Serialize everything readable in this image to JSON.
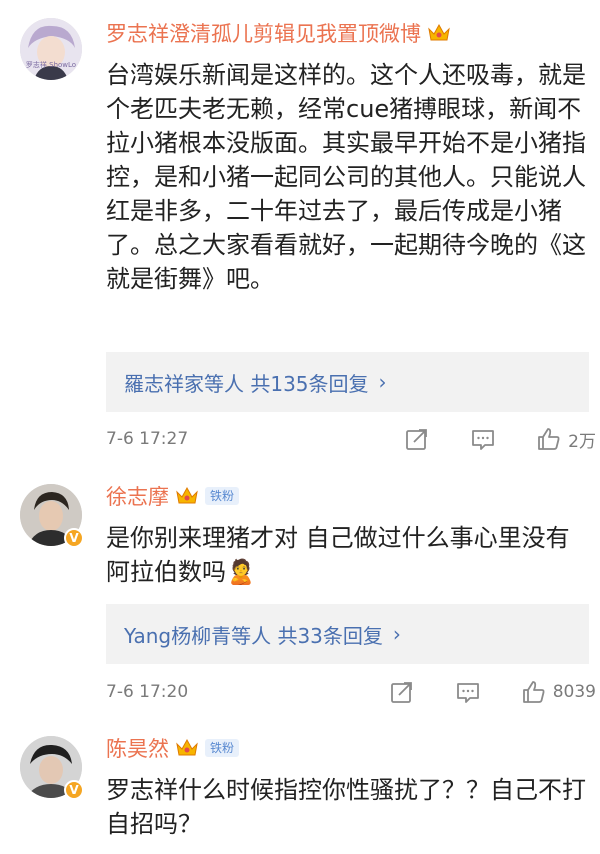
{
  "comments": [
    {
      "author": "罗志祥澄清孤儿剪辑见我置顶微博",
      "avatar_watermark": "罗志祥 ShowLo",
      "text": "台湾娱乐新闻是这样的。这个人还吸毒，就是个老匹夫老无赖，经常cue猪搏眼球，新闻不拉小猪根本没版面。其实最早开始不是小猪指控，是和小猪一起同公司的其他人。只能说人红是非多，二十年过去了，最后传成是小猪了。总之大家看看就好，一起期待今晚的《这就是街舞》吧。",
      "reply_summary": "羅志祥家等人 共135条回复",
      "chevron": "›",
      "time": "7-6 17:27",
      "likes": "2万"
    },
    {
      "author": "徐志摩",
      "badge": "铁粉",
      "verified_mark": "V",
      "text": "是你别来理猪才对 自己做过什么事心里没有阿拉伯数吗🙎",
      "reply_summary": "Yang杨柳青等人 共33条回复",
      "chevron": "›",
      "time": "7-6 17:20",
      "likes": "8039"
    },
    {
      "author": "陈昊然",
      "badge": "铁粉",
      "verified_mark": "V",
      "text": "罗志祥什么时候指控你性骚扰了？？自己不打自招吗？"
    }
  ],
  "icons": {
    "share": "share-icon",
    "comment": "comment-icon",
    "like": "thumbs-up-icon",
    "crown": "crown-icon"
  },
  "colors": {
    "author_name": "#eb7350",
    "reply_link": "#4a70b0",
    "badge_bg": "#e8f0fb",
    "badge_text": "#5a8ad1"
  }
}
